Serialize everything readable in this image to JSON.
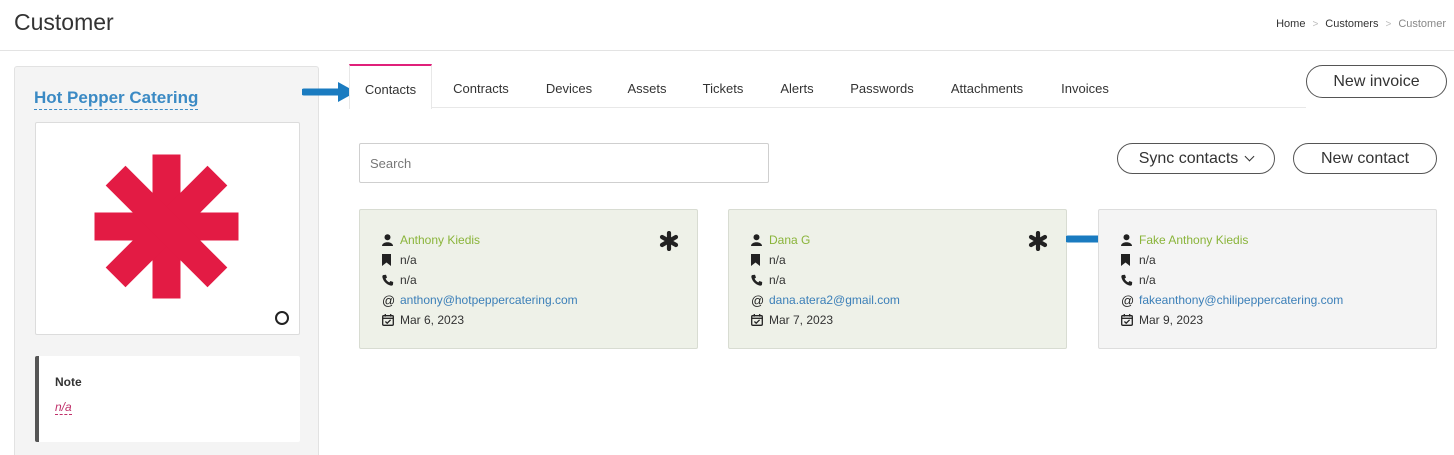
{
  "header": {
    "title": "Customer",
    "breadcrumb": [
      "Home",
      "Customers",
      "Customer"
    ]
  },
  "customer": {
    "name": "Hot Pepper Catering",
    "note_title": "Note",
    "note_value": "n/a"
  },
  "tabs": [
    {
      "label": "Contacts",
      "active": true
    },
    {
      "label": "Contracts"
    },
    {
      "label": "Devices"
    },
    {
      "label": "Assets"
    },
    {
      "label": "Tickets"
    },
    {
      "label": "Alerts"
    },
    {
      "label": "Passwords"
    },
    {
      "label": "Attachments"
    },
    {
      "label": "Invoices"
    }
  ],
  "buttons": {
    "new_invoice": "New invoice",
    "sync_contacts": "Sync contacts",
    "new_contact": "New contact"
  },
  "search": {
    "placeholder": "Search",
    "value": ""
  },
  "contacts": [
    {
      "name": "Anthony Kiedis",
      "title": "n/a",
      "phone": "n/a",
      "email": "anthony@hotpeppercatering.com",
      "date": "Mar 6, 2023",
      "primary": true
    },
    {
      "name": "Dana G",
      "title": "n/a",
      "phone": "n/a",
      "email": "dana.atera2@gmail.com",
      "date": "Mar 7, 2023",
      "primary": true
    },
    {
      "name": "Fake Anthony Kiedis",
      "title": "n/a",
      "phone": "n/a",
      "email": "fakeanthony@chilipeppercatering.com",
      "date": "Mar 9, 2023",
      "primary": false
    }
  ],
  "colors": {
    "accent": "#e0207a",
    "link": "#3b8ac4",
    "contact_name": "#8ab43a",
    "logo": "#e31b44",
    "annotation_arrow": "#1a7bc0"
  },
  "icons": {
    "user": "user-icon",
    "title": "bookmark-icon",
    "phone": "phone-icon",
    "email": "at-icon",
    "date": "calendar-check-icon",
    "primary": "asterisk-icon"
  }
}
